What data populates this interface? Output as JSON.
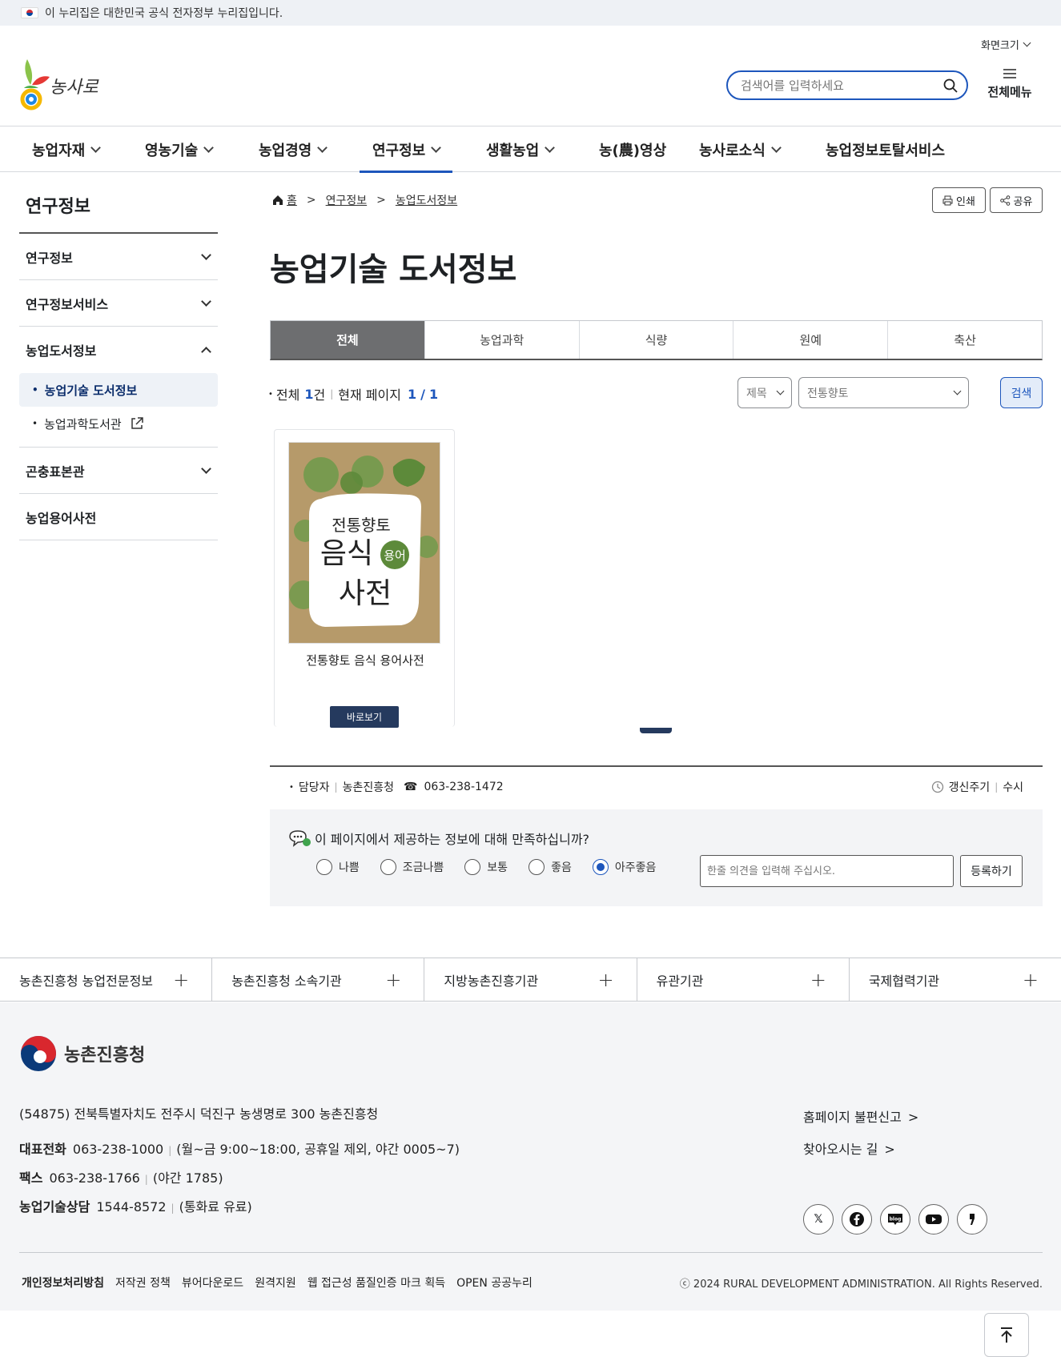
{
  "topbar": {
    "text": "이 누리집은 대한민국 공식 전자정부 누리집입니다."
  },
  "header": {
    "font_size_label": "화면크기",
    "search_placeholder": "검색어를 입력하세요",
    "all_menu": "전체메뉴",
    "logo_text": "농사로"
  },
  "gnb": [
    {
      "label": "농업자재",
      "has_sub": true
    },
    {
      "label": "영농기술",
      "has_sub": true
    },
    {
      "label": "농업경영",
      "has_sub": true
    },
    {
      "label": "연구정보",
      "has_sub": true
    },
    {
      "label": "생활농업",
      "has_sub": true
    },
    {
      "label": "농(農)영상",
      "has_sub": false
    },
    {
      "label": "농사로소식",
      "has_sub": true
    },
    {
      "label": "농업정보토탈서비스",
      "has_sub": false
    }
  ],
  "lnb": {
    "title": "연구정보",
    "items": [
      "연구정보",
      "연구정보서비스",
      "농업도서정보",
      "곤충표본관",
      "농업용어사전"
    ],
    "sub": [
      "농업기술 도서정보",
      "농업과학도서관"
    ]
  },
  "breadcrumb": [
    "홈",
    "연구정보",
    "농업도서정보"
  ],
  "tools": {
    "print": "인쇄",
    "share": "공유"
  },
  "page_title": "농업기술 도서정보",
  "tabs": [
    "전체",
    "농업과학",
    "식량",
    "원예",
    "축산"
  ],
  "summary": {
    "total_label": "전체",
    "total": "1",
    "unit": "건",
    "page_label": "현재 페이지",
    "current": "1",
    "slash": "/",
    "pages": "1"
  },
  "search": {
    "field": "제목",
    "keyword": "전통향토",
    "button": "검색"
  },
  "book": {
    "cover_line1": "전통향토",
    "cover_line2": "음식",
    "cover_badge": "용어",
    "cover_line3": "사전",
    "title": "전통향토 음식 용어사전",
    "button": "바로보기"
  },
  "manager": {
    "label": "담당자",
    "org": "농촌진흥청",
    "phone": "063-238-1472",
    "cycle_label": "갱신주기",
    "cycle": "수시"
  },
  "survey": {
    "question": "이 페이지에서 제공하는 정보에 대해 만족하십니까?",
    "options": [
      "나쁨",
      "조금나쁨",
      "보통",
      "좋음",
      "아주좋음"
    ],
    "selected": "아주좋음",
    "placeholder": "한줄 의견을 입력해 주십시오.",
    "submit": "등록하기"
  },
  "orgs": [
    "농촌진흥청 농업전문정보",
    "농촌진흥청 소속기관",
    "지방농촌진흥기관",
    "유관기관",
    "국제협력기관"
  ],
  "footer": {
    "brand": "농촌진흥청",
    "address": "(54875) 전북특별자치도 전주시 덕진구 농생명로 300 농촌진흥청",
    "tel_label": "대표전화",
    "tel": "063-238-1000",
    "tel_note": "(월~금 9:00~18:00, 공휴일 제외, 야간 0005~7)",
    "fax_label": "팩스",
    "fax": "063-238-1766",
    "fax_note": "(야간 1785)",
    "consult_label": "농업기술상담",
    "consult": "1544-8572",
    "consult_note": "(통화료 유료)",
    "links": [
      "홈페이지 불편신고",
      "찾아오시는 길"
    ],
    "policy": [
      "개인정보처리방침",
      "저작권 정책",
      "뷰어다운로드",
      "원격지원",
      "웹 접근성 품질인증 마크 획득",
      "OPEN 공공누리"
    ],
    "copyright": "ⓒ 2024 RURAL DEVELOPMENT ADMINISTRATION. All Rights Reserved.",
    "sns": [
      "x-icon",
      "facebook-icon",
      "blog-icon",
      "youtube-icon",
      "kakao-icon"
    ]
  },
  "colors": {
    "primary": "#1d56bc",
    "navy": "#253a5e",
    "tab_active": "#6d6e70"
  }
}
